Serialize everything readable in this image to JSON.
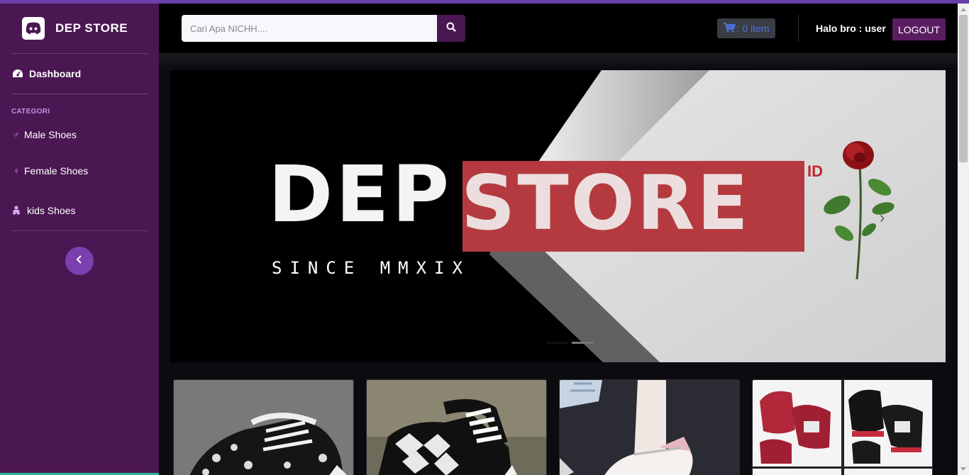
{
  "brand": {
    "name": "DEP STORE",
    "logo_icon": "discord-icon"
  },
  "sidebar": {
    "dashboard": {
      "label": "Dashboard",
      "icon": "tachometer-icon"
    },
    "category_heading": "CATEGORI",
    "categories": [
      {
        "label": "Male Shoes",
        "icon": "mars-icon"
      },
      {
        "label": "Female Shoes",
        "icon": "venus-icon"
      },
      {
        "label": "kids Shoes",
        "icon": "baby-icon"
      }
    ],
    "toggle_icon": "chevron-left-icon"
  },
  "topbar": {
    "search_placeholder": "Cari Apa NICHH....",
    "search_icon": "search-icon",
    "cart_icon": "cart-icon",
    "cart_text": ": 0 item",
    "greeting_label": "Halo bro",
    "greeting_user": ": user",
    "logout_label": "LOGOUT"
  },
  "banner": {
    "word1": "DEP",
    "word2": "STORE",
    "badge": "ID",
    "tagline": "SINCE MMXIX",
    "slides_total": 2,
    "active_slide": 1
  },
  "products": [
    {
      "name": "product-card-1",
      "style": "black canvas print sneaker"
    },
    {
      "name": "product-card-2",
      "style": "checkered high-top sneaker"
    },
    {
      "name": "product-card-3",
      "style": "white chunky sneaker"
    },
    {
      "name": "product-card-4",
      "style": "red and black wedges"
    }
  ],
  "colors": {
    "sidebar": "#4a1752",
    "accent": "#7b3fae",
    "logout": "#5a1d62",
    "cart_text": "#4e73df",
    "banner_red": "#b43a3f"
  }
}
